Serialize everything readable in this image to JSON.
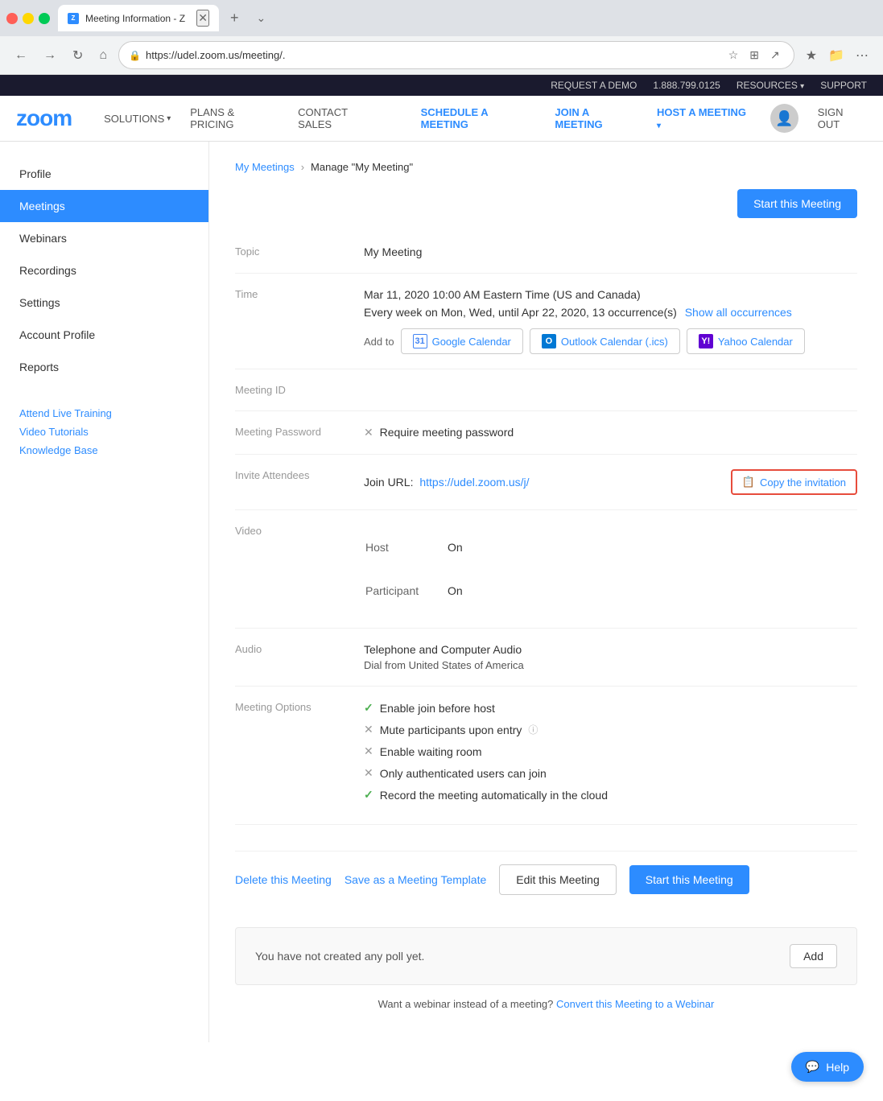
{
  "browser": {
    "tab_title": "Meeting Information - Z",
    "url": "https://udel.zoom.us/meeting/.",
    "favicon_text": "Z"
  },
  "top_bar": {
    "request_demo": "REQUEST A DEMO",
    "phone": "1.888.799.0125",
    "resources": "RESOURCES",
    "support": "SUPPORT"
  },
  "nav": {
    "logo": "zoom",
    "solutions": "SOLUTIONS",
    "plans": "PLANS & PRICING",
    "contact_sales": "CONTACT SALES",
    "schedule": "SCHEDULE A MEETING",
    "join": "JOIN A MEETING",
    "host": "HOST A MEETING",
    "sign_out": "SIGN OUT"
  },
  "sidebar": {
    "items": [
      {
        "label": "Profile",
        "active": false
      },
      {
        "label": "Meetings",
        "active": true
      },
      {
        "label": "Webinars",
        "active": false
      },
      {
        "label": "Recordings",
        "active": false
      },
      {
        "label": "Settings",
        "active": false
      },
      {
        "label": "Account Profile",
        "active": false
      },
      {
        "label": "Reports",
        "active": false
      }
    ],
    "links": [
      {
        "label": "Attend Live Training"
      },
      {
        "label": "Video Tutorials"
      },
      {
        "label": "Knowledge Base"
      }
    ]
  },
  "breadcrumb": {
    "parent": "My Meetings",
    "current": "Manage \"My Meeting\""
  },
  "start_meeting_btn_top": "Start this Meeting",
  "meeting": {
    "topic_label": "Topic",
    "topic_value": "My Meeting",
    "time_label": "Time",
    "time_value": "Mar 11, 2020 10:00 AM Eastern Time (US and Canada)",
    "recurrence": "Every week on Mon, Wed, until Apr 22, 2020, 13 occurrence(s)",
    "show_all": "Show all",
    "occurrences": "occurrences",
    "add_to_label": "Add to",
    "google_cal": "Google Calendar",
    "outlook_cal": "Outlook Calendar (.ics)",
    "yahoo_cal": "Yahoo Calendar",
    "meeting_id_label": "Meeting ID",
    "meeting_id_value": "",
    "password_label": "Meeting Password",
    "password_icon": "✕",
    "password_value": "Require meeting password",
    "invite_label": "Invite Attendees",
    "join_url_label": "Join URL:",
    "join_url": "https://udel.zoom.us/j/",
    "copy_invite": "Copy the invitation",
    "video_label": "Video",
    "host_label": "Host",
    "host_value": "On",
    "participant_label": "Participant",
    "participant_value": "On",
    "audio_label": "Audio",
    "audio_value": "Telephone and Computer Audio",
    "dial_from": "Dial from United States of America",
    "options_label": "Meeting Options",
    "options": [
      {
        "enabled": true,
        "text": "Enable join before host"
      },
      {
        "enabled": false,
        "text": "Mute participants upon entry",
        "has_info": true
      },
      {
        "enabled": false,
        "text": "Enable waiting room"
      },
      {
        "enabled": false,
        "text": "Only authenticated users can join"
      },
      {
        "enabled": true,
        "text": "Record the meeting automatically in the cloud"
      }
    ]
  },
  "bottom_actions": {
    "delete": "Delete this Meeting",
    "save_template": "Save as a Meeting Template",
    "edit": "Edit this Meeting",
    "start": "Start this Meeting"
  },
  "poll": {
    "text": "You have not created any poll yet.",
    "add_btn": "Add"
  },
  "footer": {
    "text": "Want a webinar instead of a meeting?",
    "link": "Convert this Meeting to a Webinar"
  },
  "help_btn": "Help"
}
